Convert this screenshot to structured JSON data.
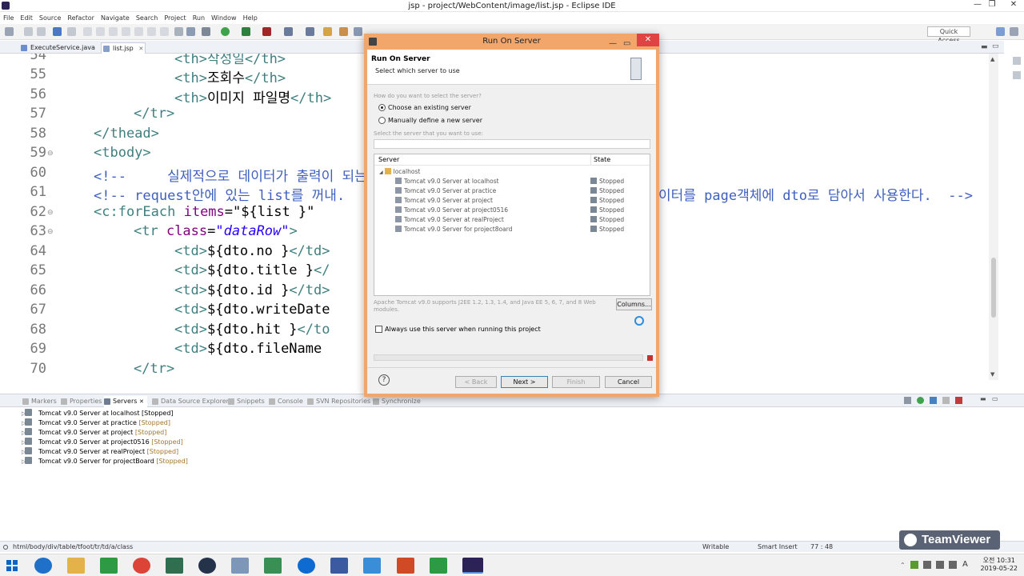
{
  "window": {
    "title": "jsp - project/WebContent/image/list.jsp - Eclipse IDE",
    "controls": [
      "—",
      "❐",
      "✕"
    ]
  },
  "menu": [
    "File",
    "Edit",
    "Source",
    "Refactor",
    "Navigate",
    "Search",
    "Project",
    "Run",
    "Window",
    "Help"
  ],
  "toolbar": {
    "quick_access": "Quick Access"
  },
  "editor_tabs": [
    {
      "label": "ExecuteService.java",
      "active": false
    },
    {
      "label": "list.jsp",
      "active": true,
      "close": "✕"
    }
  ],
  "editor": {
    "lines": [
      {
        "no": "54",
        "fold": ""
      },
      {
        "no": "55",
        "fold": ""
      },
      {
        "no": "56",
        "fold": ""
      },
      {
        "no": "57",
        "fold": ""
      },
      {
        "no": "58",
        "fold": ""
      },
      {
        "no": "59",
        "fold": "⊖"
      },
      {
        "no": "60",
        "fold": ""
      },
      {
        "no": "61",
        "fold": ""
      },
      {
        "no": "62",
        "fold": "⊖"
      },
      {
        "no": "63",
        "fold": "⊖"
      },
      {
        "no": "64",
        "fold": ""
      },
      {
        "no": "65",
        "fold": ""
      },
      {
        "no": "66",
        "fold": ""
      },
      {
        "no": "67",
        "fold": ""
      },
      {
        "no": "68",
        "fold": ""
      },
      {
        "no": "69",
        "fold": ""
      },
      {
        "no": "70",
        "fold": ""
      }
    ],
    "code": {
      "l54": "<th>작성일</th>",
      "l55_a": "<th>",
      "l55_b": "조회수",
      "l55_c": "</th>",
      "l56_a": "<th>",
      "l56_b": "이미지 파일명",
      "l56_c": "</th>",
      "l57": "</tr>",
      "l58": "</thead>",
      "l59": "<tbody>",
      "l60": "<!--     실제적으로 데이터가 출력이 되는",
      "l61_a": "<!-- request안에 있는 list를 꺼내.",
      "l61_b": "이터를 page객체에 dto로 담아서 사용한다.  -->",
      "l62_a": "<c:forEach ",
      "l62_b": "items",
      "l62_c": "=",
      "l62_d": "\"${list }\"",
      "l63_a": "<tr ",
      "l63_b": "class",
      "l63_c": "=",
      "l63_d": "\"dataRow\"",
      "l63_e": ">",
      "l64_a": "<td>",
      "l64_b": "${dto.no }",
      "l64_c": "</td>",
      "l65_a": "<td>",
      "l65_b": "${dto.title }",
      "l65_c": "</",
      "l66_a": "<td>",
      "l66_b": "${dto.id }",
      "l66_c": "</td>",
      "l67_a": "<td>",
      "l67_b": "${dto.writeDate",
      "l68_a": "<td>",
      "l68_b": "${dto.hit }",
      "l68_c": "</to",
      "l69_a": "<td>",
      "l69_b": "${dto.fileName",
      "l70": "</tr>"
    }
  },
  "bottom_tabs": [
    "Markers",
    "Properties",
    "Servers",
    "Data Source Explorer",
    "Snippets",
    "Console",
    "SVN Repositories",
    "Synchronize"
  ],
  "servers_view": [
    {
      "name": "Tomcat v9.0 Server at localhost",
      "state": "[Stopped]"
    },
    {
      "name": "Tomcat v9.0 Server at practice",
      "state": "[Stopped]"
    },
    {
      "name": "Tomcat v9.0 Server at project",
      "state": "[Stopped]"
    },
    {
      "name": "Tomcat v9.0 Server at project0516",
      "state": "[Stopped]"
    },
    {
      "name": "Tomcat v9.0 Server at realProject",
      "state": "[Stopped]"
    },
    {
      "name": "Tomcat v9.0 Server for projectBoard",
      "state": "[Stopped]"
    }
  ],
  "status_bar": {
    "path": "html/body/div/table/tfoot/tr/td/a/class",
    "writable": "Writable",
    "insert_mode": "Smart Insert",
    "position": "77 : 48"
  },
  "teamviewer": "TeamViewer",
  "taskbar": {
    "time": "오전 10:31",
    "date": "2019-05-22"
  },
  "dialog": {
    "title": "Run On Server",
    "heading": "Run On Server",
    "subheading": "Select which server to use",
    "question": "How do you want to select the server?",
    "radio_existing": "Choose an existing server",
    "radio_new": "Manually define a new server",
    "select_label": "Select the server that you want to use:",
    "col_server": "Server",
    "col_state": "State",
    "group": "localhost",
    "servers": [
      {
        "name": "Tomcat v9.0 Server at localhost",
        "state": "Stopped"
      },
      {
        "name": "Tomcat v9.0 Server at practice",
        "state": "Stopped"
      },
      {
        "name": "Tomcat v9.0 Server at project",
        "state": "Stopped"
      },
      {
        "name": "Tomcat v9.0 Server at project0516",
        "state": "Stopped"
      },
      {
        "name": "Tomcat v9.0 Server at realProject",
        "state": "Stopped"
      },
      {
        "name": "Tomcat v9.0 Server for project8oard",
        "state": "Stopped"
      }
    ],
    "description_1": "Apache Tomcat v9.0 supports J2EE 1.2, 1.3, 1.4, and Java EE 5, 6, 7, and 8 Web",
    "description_2": "modules.",
    "columns_button": "Columns...",
    "always_checkbox": "Always use this server when running this project",
    "help": "?",
    "back": "< Back",
    "next": "Next >",
    "finish": "Finish",
    "cancel": "Cancel"
  }
}
